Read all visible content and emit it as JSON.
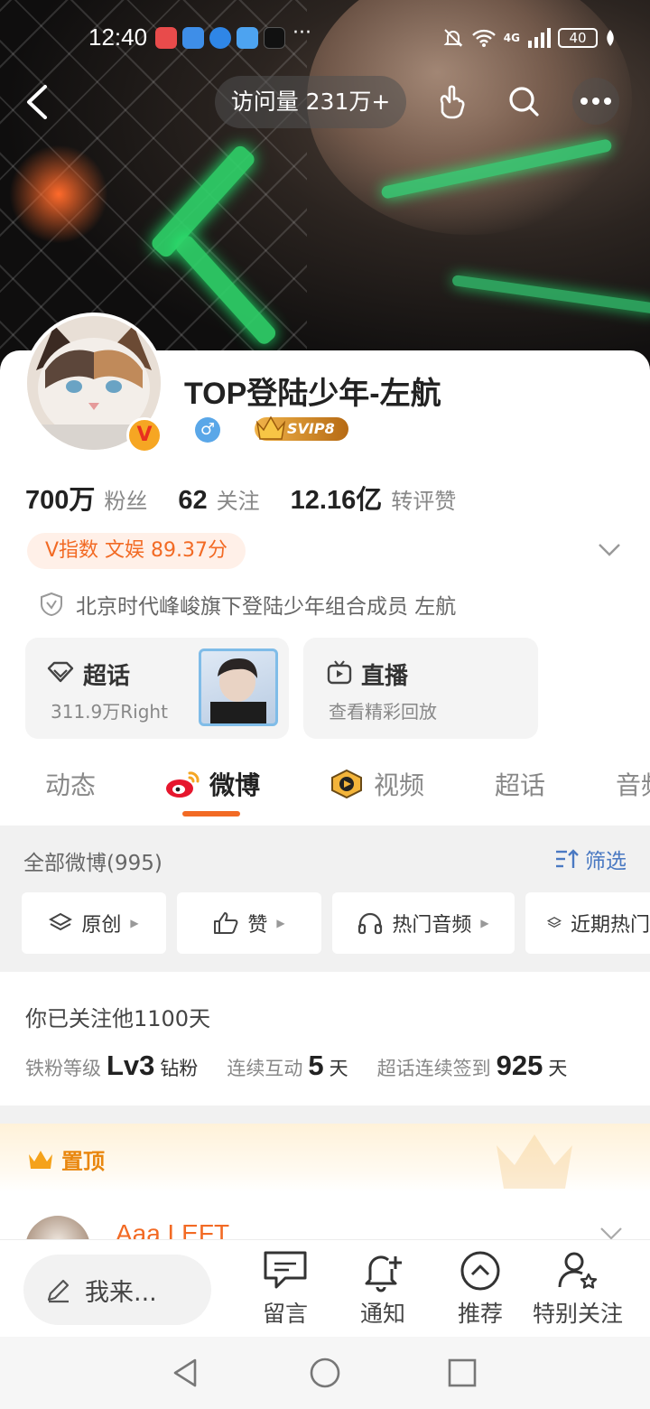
{
  "status_bar": {
    "time": "12:40",
    "network": "4G",
    "battery": "40"
  },
  "top_nav": {
    "visits": "访问量 231万+"
  },
  "profile": {
    "name": "TOP登陆少年-左航",
    "gender_symbol": "♂",
    "vip_badge": "SVIP8",
    "stats": [
      {
        "value": "700万",
        "label": "粉丝"
      },
      {
        "value": "62",
        "label": "关注"
      },
      {
        "value": "12.16亿",
        "label": "转评赞"
      }
    ],
    "v_index": "V指数 文娱 89.37分",
    "bio": "北京时代峰峻旗下登陆少年组合成员 左航"
  },
  "tiles": {
    "supertopic": {
      "title": "超话",
      "subtitle": "311.9万Right"
    },
    "live": {
      "title": "直播",
      "subtitle": "查看精彩回放"
    }
  },
  "tabs": [
    "动态",
    "微博",
    "视频",
    "超话",
    "音频"
  ],
  "active_tab": "微博",
  "filter": {
    "title": "全部微博(995)",
    "filter_label": "筛选",
    "chips": [
      "原创",
      "赞",
      "热门音频",
      "近期热门"
    ]
  },
  "fan_info": {
    "follow_days": "你已关注他1100天",
    "level_label": "铁粉等级",
    "level_value": "Lv3",
    "level_suffix": "钻粉",
    "interact_label": "连续互动",
    "interact_value": "5",
    "interact_unit": "天",
    "checkin_label": "超话连续签到",
    "checkin_value": "925",
    "checkin_unit": "天"
  },
  "pinned": {
    "label": "置顶"
  },
  "post": {
    "author": "Aaa LEFT"
  },
  "bottom_bar": {
    "compose_placeholder": "我来...",
    "items": [
      "留言",
      "通知",
      "推荐",
      "特别关注"
    ]
  },
  "colors": {
    "accent": "#f26a24",
    "link": "#4a79c2",
    "gold": "#e9870f"
  }
}
